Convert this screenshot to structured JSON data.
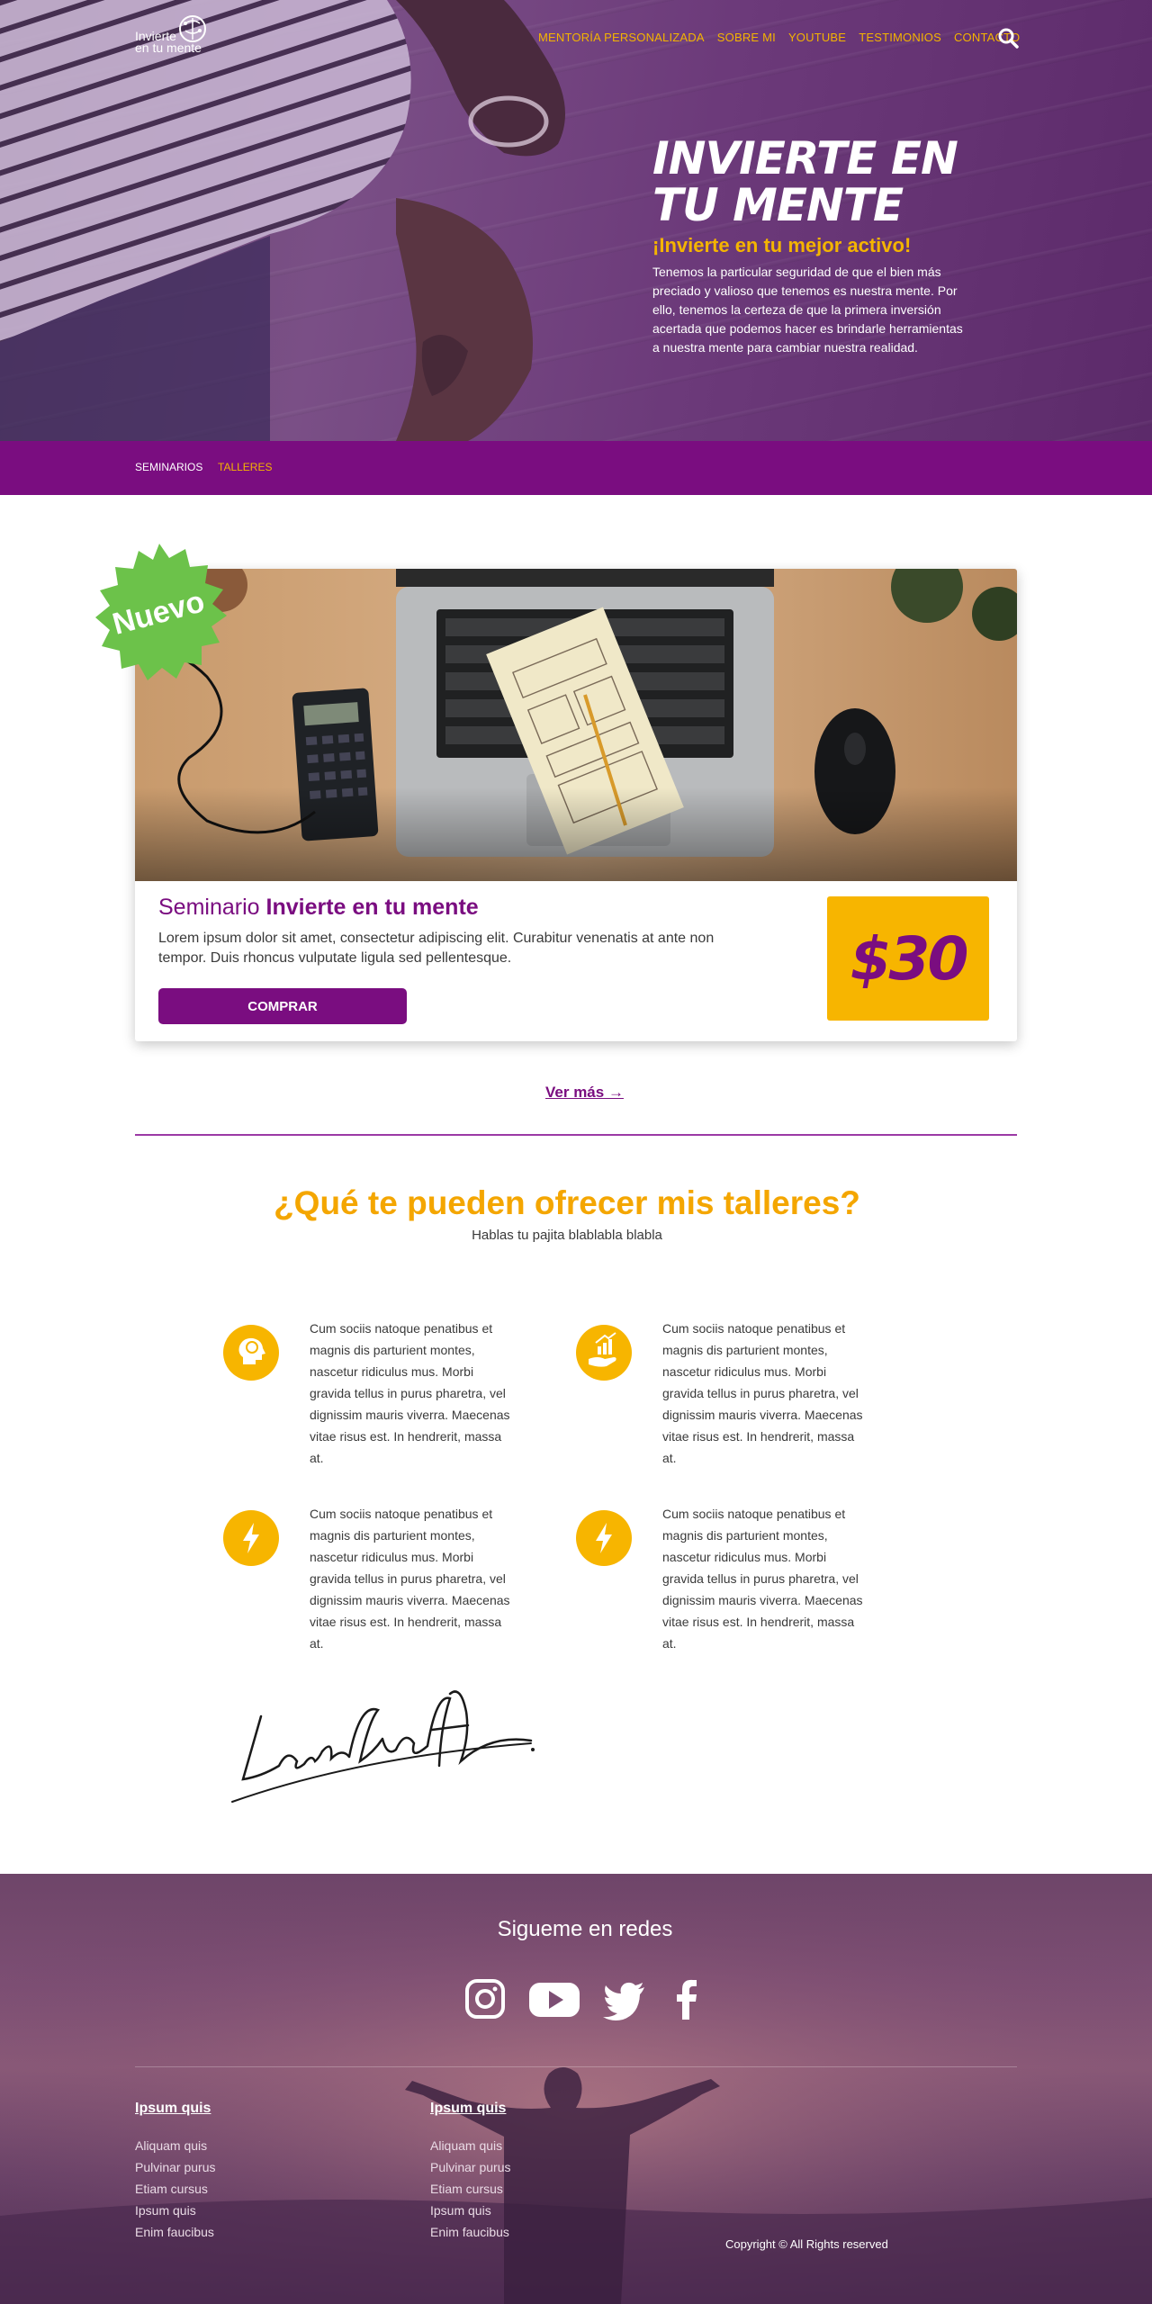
{
  "header": {
    "logo_line1": "Invierte",
    "logo_line2": "en tu mente",
    "nav": [
      "MENTORÍA PERSONALIZADA",
      "SOBRE MI",
      "YOUTUBE",
      "TESTIMONIOS",
      "CONTACTO"
    ],
    "search_icon": "search-icon"
  },
  "hero": {
    "title_line1": "INVIERTE EN",
    "title_line2": "TU MENTE",
    "subtitle": "¡Invierte en tu mejor activo!",
    "text": "Tenemos la particular seguridad de que el bien más preciado y valioso que tenemos es nuestra mente. Por ello, tenemos la certeza de que la primera inversión acertada que podemos hacer es brindarle herramientas a nuestra mente para cambiar nuestra realidad."
  },
  "tabs": {
    "items": [
      "SEMINARIOS",
      "TALLERES"
    ],
    "active": "TALLERES"
  },
  "card": {
    "badge": "Nuevo",
    "title_prefix": "Seminario",
    "title_bold": "Invierte en tu mente",
    "description": "Lorem ipsum dolor sit amet, consectetur adipiscing elit. Curabitur venenatis at ante non tempor. Duis rhoncus vulputate ligula sed pellentesque.",
    "buy_label": "COMPRAR",
    "price": "$30"
  },
  "more_link": "Ver más →",
  "offer": {
    "title": "¿Qué te pueden ofrecer mis talleres?",
    "subtitle": "Hablas tu pajita blablabla blabla",
    "features": [
      {
        "icon": "brain-head-icon",
        "text": "Cum sociis natoque penatibus et magnis dis parturient montes, nascetur ridiculus mus. Morbi gravida tellus in purus pharetra, vel dignissim mauris viverra. Maecenas vitae risus est. In hendrerit, massa at."
      },
      {
        "icon": "growth-hand-icon",
        "text": "Cum sociis natoque penatibus et magnis dis parturient montes, nascetur ridiculus mus. Morbi gravida tellus in purus pharetra, vel dignissim mauris viverra. Maecenas vitae risus est. In hendrerit, massa at."
      },
      {
        "icon": "lightning-icon",
        "text": "Cum sociis natoque penatibus et magnis dis parturient montes, nascetur ridiculus mus. Morbi gravida tellus in purus pharetra, vel dignissim mauris viverra. Maecenas vitae risus est. In hendrerit, massa at."
      },
      {
        "icon": "lightning-icon",
        "text": "Cum sociis natoque penatibus et magnis dis parturient montes, nascetur ridiculus mus. Morbi gravida tellus in purus pharetra, vel dignissim mauris viverra. Maecenas vitae risus est. In hendrerit, massa at."
      }
    ],
    "signature": "LaraCroft"
  },
  "footer": {
    "follow": "Sigueme en redes",
    "social": [
      "instagram-icon",
      "youtube-icon",
      "twitter-icon",
      "facebook-icon"
    ],
    "col1": {
      "heading": "Ipsum quis",
      "items": [
        "Aliquam quis",
        "Pulvinar purus",
        "Etiam cursus",
        "Ipsum quis",
        "Enim faucibus"
      ]
    },
    "col2": {
      "heading": "Ipsum quis",
      "items": [
        "Aliquam quis",
        "Pulvinar purus",
        "Etiam cursus",
        "Ipsum quis",
        "Enim faucibus"
      ]
    },
    "copyright": "Copyright © All Rights reserved"
  },
  "colors": {
    "purple": "#7a0d80",
    "yellow": "#f7b500",
    "orange_title": "#f4a600",
    "green_badge": "#6cc24a"
  }
}
